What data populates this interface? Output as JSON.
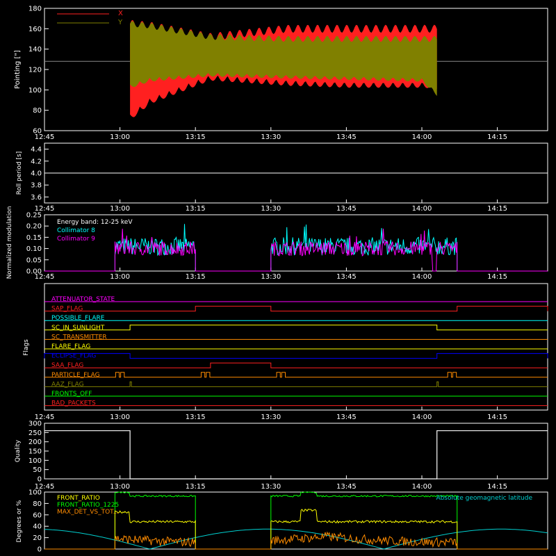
{
  "colors": {
    "background": "#000000",
    "axes": "#ffffff",
    "pointing_x": "#ff2020",
    "pointing_y": "#808000",
    "collimator8": "#00ffff",
    "collimator9": "#ff00ff",
    "front_ratio": "#ffff00",
    "front_ratio_1225": "#00ff00",
    "max_det": "#ff8c00",
    "geomag": "#00d0d0"
  },
  "chart_data": [
    {
      "type": "line",
      "ylabel": "Pointing [\"]",
      "ylim": [
        60,
        180
      ],
      "yticks": [
        60,
        80,
        100,
        120,
        140,
        160,
        180
      ],
      "xlim": [
        "12:45",
        "14:25"
      ],
      "xticks": [
        "12:45",
        "13:00",
        "13:15",
        "13:30",
        "13:45",
        "14:00",
        "14:15"
      ],
      "reference_line": 128,
      "series": [
        {
          "name": "X",
          "color": "#ff2020",
          "envelope_upper": [
            [
              13.03,
              165
            ],
            [
              13.1,
              163
            ],
            [
              13.3,
              152
            ],
            [
              13.55,
              160
            ],
            [
              13.75,
              160
            ],
            [
              14.0,
              160
            ],
            [
              14.05,
              160
            ]
          ],
          "envelope_lower": [
            [
              13.03,
              75
            ],
            [
              13.1,
              92
            ],
            [
              13.3,
              115
            ],
            [
              13.55,
              110
            ],
            [
              13.75,
              108
            ],
            [
              14.0,
              108
            ],
            [
              14.05,
              107
            ]
          ]
        },
        {
          "name": "Y",
          "color": "#808000",
          "envelope_upper": [
            [
              13.03,
              165
            ],
            [
              13.1,
              163
            ],
            [
              13.3,
              152
            ],
            [
              13.55,
              150
            ],
            [
              14.0,
              150
            ],
            [
              14.05,
              150
            ]
          ],
          "envelope_lower": [
            [
              13.03,
              105
            ],
            [
              13.1,
              112
            ],
            [
              13.3,
              117
            ],
            [
              13.55,
              115
            ],
            [
              14.0,
              112
            ],
            [
              14.05,
              98
            ]
          ]
        }
      ],
      "data_start": "13:02",
      "data_end": "14:03"
    },
    {
      "type": "line",
      "ylabel": "Roll period [s]",
      "ylim": [
        3.5,
        4.5
      ],
      "yticks": [
        3.6,
        3.8,
        4.0,
        4.2,
        4.4
      ],
      "xticks": [
        "12:45",
        "13:00",
        "13:15",
        "13:30",
        "13:45",
        "14:00",
        "14:15"
      ],
      "series": [
        {
          "values_constant": 4.0,
          "start": "12:45",
          "end": "14:25"
        }
      ]
    },
    {
      "type": "line",
      "ylabel": "Normalized modulation",
      "ylim": [
        0.0,
        0.25
      ],
      "yticks": [
        0.0,
        0.05,
        0.1,
        0.15,
        0.2,
        0.25
      ],
      "xticks": [
        "12:45",
        "13:00",
        "13:15",
        "13:30",
        "13:45",
        "14:00",
        "14:15"
      ],
      "legend_title": "Energy band: 12-25 keV",
      "series": [
        {
          "name": "Collimator 8",
          "color": "#00ffff",
          "segments": [
            [
              "12:59",
              "13:15"
            ],
            [
              "13:30",
              "14:07"
            ]
          ],
          "mean": 0.11,
          "spread": 0.05
        },
        {
          "name": "Collimator 9",
          "color": "#ff00ff",
          "segments": [
            [
              "12:59",
              "13:15"
            ],
            [
              "13:30",
              "14:02"
            ],
            [
              "14:02",
              "14:07"
            ]
          ],
          "mean": 0.1,
          "spread": 0.04
        }
      ]
    },
    {
      "type": "line",
      "ylabel": "Flags",
      "xticks": [
        "12:45",
        "13:00",
        "13:15",
        "13:30",
        "13:45",
        "14:00",
        "14:15"
      ],
      "flags": [
        {
          "name": "ATTENUATOR_STATE",
          "color": "#ff00ff",
          "steps": []
        },
        {
          "name": "SAP_FLAG",
          "color": "#ff2020",
          "steps": [
            [
              "13:15",
              "13:30"
            ],
            [
              "14:07",
              "14:25"
            ]
          ]
        },
        {
          "name": "POSSIBLE_FLARE",
          "color": "#00ffff",
          "steps": []
        },
        {
          "name": "SC_IN_SUNLIGHT",
          "color": "#ffff00",
          "steps": [
            [
              "13:02",
              "14:03"
            ]
          ]
        },
        {
          "name": "SC_TRANSMITTER",
          "color": "#ff8c00",
          "steps": []
        },
        {
          "name": "FLARE_FLAG",
          "color": "#ffff00",
          "steps": []
        },
        {
          "name": "ECLIPSE_FLAG",
          "color": "#0000ff",
          "steps": [
            [
              "12:45",
              "13:02"
            ],
            [
              "14:03",
              "14:25"
            ]
          ]
        },
        {
          "name": "SAA_FLAG",
          "color": "#ff2020",
          "steps": [
            [
              "13:18",
              "13:30"
            ]
          ]
        },
        {
          "name": "PARTICLE_FLAG",
          "color": "#ff8c00",
          "steps": []
        },
        {
          "name": "AAZ_FLAG",
          "color": "#808000",
          "steps": []
        },
        {
          "name": "FRONTS_OFF",
          "color": "#00ff00",
          "steps": []
        },
        {
          "name": "BAD_PACKETS",
          "color": "#ff2020",
          "steps": []
        }
      ]
    },
    {
      "type": "line",
      "ylabel": "Quality",
      "ylim": [
        0,
        300
      ],
      "yticks": [
        0,
        50,
        100,
        150,
        200,
        250,
        300
      ],
      "xticks": [
        "12:45",
        "13:00",
        "13:15",
        "13:30",
        "13:45",
        "14:00",
        "14:15"
      ],
      "series": [
        {
          "steps": [
            [
              "12:45",
              260
            ],
            [
              "13:02",
              0
            ],
            [
              "14:03",
              260
            ],
            [
              "14:25",
              260
            ]
          ]
        }
      ]
    },
    {
      "type": "line",
      "ylabel": "Degrees or %",
      "ylim": [
        0,
        100
      ],
      "yticks": [
        0,
        20,
        40,
        60,
        80,
        100
      ],
      "xticks": [
        "12:45",
        "13:00",
        "13:15",
        "13:30",
        "13:45",
        "14:00",
        "14:15"
      ],
      "series": [
        {
          "name": "FRONT_RATIO",
          "color": "#ffff00"
        },
        {
          "name": "FRONT_RATIO_1225",
          "color": "#00ff00"
        },
        {
          "name": "MAX_DET_VS_TOT...",
          "color": "#ff8c00"
        },
        {
          "name": "Absolute geomagnetic latitude",
          "color": "#00d0d0"
        }
      ]
    }
  ],
  "legend_pointing": [
    "X",
    "Y"
  ]
}
